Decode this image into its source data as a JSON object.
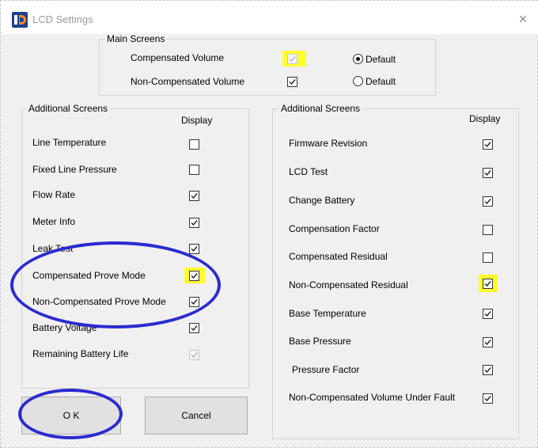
{
  "window": {
    "title": "LCD Settings",
    "close_glyph": "×",
    "app_icon": "app-logo-icon"
  },
  "main_screens": {
    "title": "Main Screens",
    "rows": [
      {
        "label": "Compensated Volume",
        "checked": true,
        "disabled": true,
        "highlighted": true,
        "radio_label": "Default",
        "radio_selected": true
      },
      {
        "label": "Non-Compensated Volume",
        "checked": true,
        "disabled": false,
        "highlighted": false,
        "radio_label": "Default",
        "radio_selected": false
      }
    ]
  },
  "left_panel": {
    "title": "Additional Screens",
    "display_header": "Display",
    "items": [
      {
        "label": "Line Temperature",
        "checked": false
      },
      {
        "label": "Fixed Line Pressure",
        "checked": false
      },
      {
        "label": "Flow Rate",
        "checked": true
      },
      {
        "label": "Meter Info",
        "checked": true
      },
      {
        "label": "Leak Test",
        "checked": true
      },
      {
        "label": "Compensated Prove Mode",
        "checked": true,
        "highlighted": true
      },
      {
        "label": "Non-Compensated Prove Mode",
        "checked": true
      },
      {
        "label": "Battery Voltage",
        "checked": true
      },
      {
        "label": "Remaining Battery Life",
        "checked": true,
        "disabled": true
      }
    ]
  },
  "right_panel": {
    "title": "Additional Screens",
    "display_header": "Display",
    "items": [
      {
        "label": "Firmware Revision",
        "checked": true
      },
      {
        "label": "LCD Test",
        "checked": true
      },
      {
        "label": "Change Battery",
        "checked": true
      },
      {
        "label": "Compensation Factor",
        "checked": false
      },
      {
        "label": "Compensated Residual",
        "checked": false
      },
      {
        "label": "Non-Compensated Residual",
        "checked": true,
        "highlighted": true
      },
      {
        "label": "Base Temperature",
        "checked": true
      },
      {
        "label": "Base Pressure",
        "checked": true
      },
      {
        "label": "Pressure Factor",
        "checked": true
      },
      {
        "label": "Non-Compensated Volume Under Fault",
        "checked": true
      }
    ]
  },
  "buttons": {
    "ok": "O K",
    "cancel": "Cancel"
  },
  "colors": {
    "highlight": "#ffff2e",
    "annotation": "#2b2bd0",
    "dialog_bg": "#f0f0f0"
  }
}
